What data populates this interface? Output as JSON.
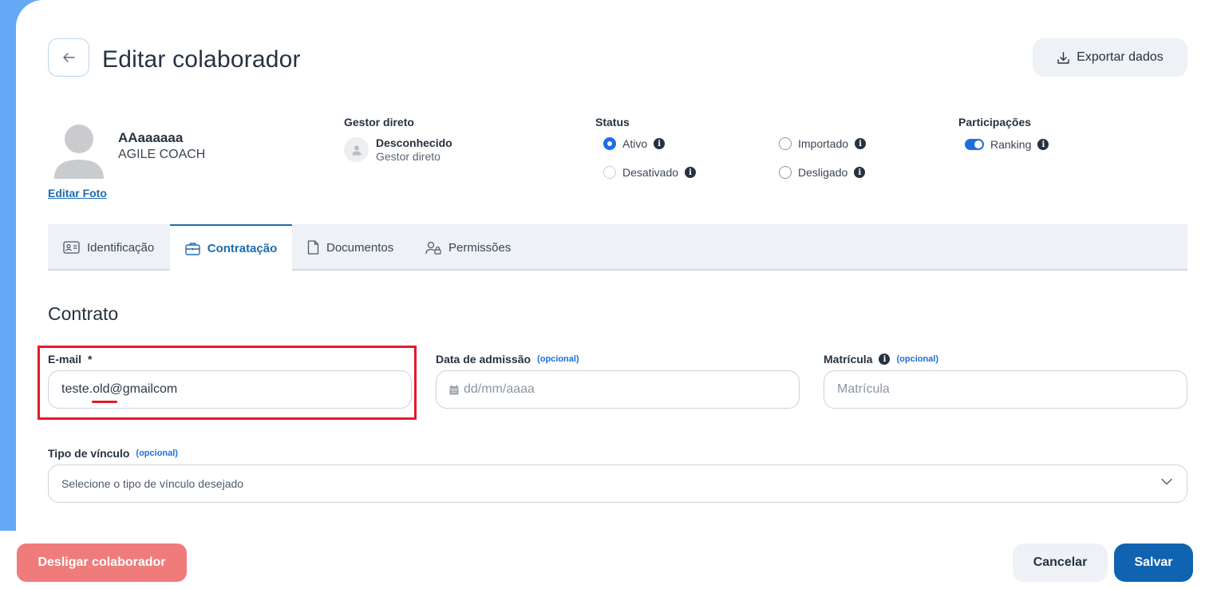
{
  "header": {
    "title": "Editar colaborador",
    "export_label": "Exportar dados"
  },
  "profile": {
    "name": "AAaaaaaa",
    "role": "AGILE COACH",
    "edit_photo_label": "Editar Foto"
  },
  "manager": {
    "label": "Gestor direto",
    "name": "Desconhecido",
    "sub": "Gestor direto"
  },
  "status": {
    "label": "Status",
    "options": [
      {
        "label": "Ativo",
        "checked": true
      },
      {
        "label": "Importado",
        "checked": false
      },
      {
        "label": "Desativado",
        "checked": false
      },
      {
        "label": "Desligado",
        "checked": false
      }
    ]
  },
  "participations": {
    "label": "Participações",
    "ranking_label": "Ranking",
    "ranking_on": true
  },
  "tabs": [
    {
      "label": "Identificação",
      "active": false
    },
    {
      "label": "Contratação",
      "active": true
    },
    {
      "label": "Documentos",
      "active": false
    },
    {
      "label": "Permissões",
      "active": false
    }
  ],
  "contract": {
    "title": "Contrato",
    "email": {
      "label": "E-mail",
      "required": "*",
      "value": "teste.old@gmailcom"
    },
    "admission": {
      "label": "Data de admissão",
      "optional": "(opcional)",
      "placeholder": "dd/mm/aaaa"
    },
    "registration": {
      "label": "Matrícula",
      "optional": "(opcional)",
      "placeholder": "Matrícula"
    },
    "link_type": {
      "label": "Tipo de vínculo",
      "optional": "(opcional)",
      "placeholder": "Selecione o tipo de vínculo desejado"
    }
  },
  "footer": {
    "dismiss_label": "Desligar colaborador",
    "cancel_label": "Cancelar",
    "save_label": "Salvar"
  },
  "colors": {
    "accent": "#1d6fe0",
    "primary_button": "#1063b0",
    "danger_button": "#f07b7b",
    "highlight_box": "#e01b2b"
  }
}
